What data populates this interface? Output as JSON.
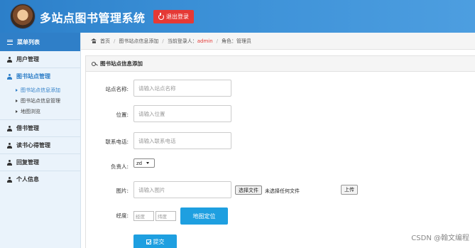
{
  "header": {
    "title": "多站点图书管理系统",
    "logout_label": "退出登录"
  },
  "sidebar": {
    "header": "菜单列表",
    "items": [
      {
        "label": "用户管理"
      },
      {
        "label": "图书站点管理",
        "active": true,
        "children": [
          {
            "label": "图书站点信息添加",
            "active": true
          },
          {
            "label": "图书站点信息管理"
          },
          {
            "label": "地图浏览"
          }
        ]
      },
      {
        "label": "借书管理"
      },
      {
        "label": "读书心得管理"
      },
      {
        "label": "回复管理"
      },
      {
        "label": "个人信息"
      }
    ]
  },
  "breadcrumb": {
    "home": "首页",
    "page": "图书站点信息添加",
    "login_prefix": "当前登录人：",
    "user": "admin",
    "role": "角色：管理员"
  },
  "panel": {
    "title": "图书站点信息添加"
  },
  "form": {
    "name_label": "站点名称:",
    "name_placeholder": "请输入站点名称",
    "location_label": "位置:",
    "location_placeholder": "请输入位置",
    "phone_label": "联系电话:",
    "phone_placeholder": "请输入联系电话",
    "manager_label": "负责人:",
    "manager_value": "zd",
    "image_label": "图片:",
    "image_placeholder": "请输入图片",
    "choose_file_label": "选择文件",
    "no_file_text": "未选择任何文件",
    "upload_label": "上传",
    "coord_label": "经度:",
    "lng_placeholder": "经度",
    "lat_placeholder": "纬度",
    "map_button": "地图定位",
    "submit_label": "提交"
  },
  "watermark": "CSDN @翰文编程",
  "colors": {
    "header_blue": "#3a8fd6",
    "accent_blue": "#1e9fe0",
    "logout_red": "#e53935"
  }
}
